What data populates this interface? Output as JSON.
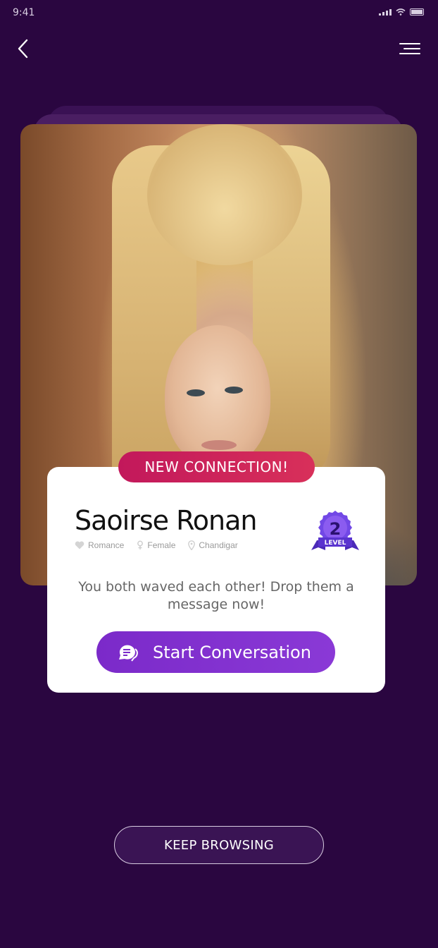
{
  "status_bar": {
    "time": "9:41"
  },
  "nav": {
    "back_icon": "chevron-left-icon",
    "menu_icon": "menu-icon"
  },
  "connection_banner": {
    "label": "NEW CONNECTION!"
  },
  "profile": {
    "name": "Saoirse Ronan",
    "meta": [
      {
        "icon": "heart-icon",
        "label": "Romance"
      },
      {
        "icon": "female-icon",
        "label": "Female"
      },
      {
        "icon": "location-pin-icon",
        "label": "Chandigar"
      }
    ],
    "level_number": "2",
    "level_label": "LEVEL"
  },
  "message": "You both waved each other! Drop them a message now!",
  "start_button": {
    "label": "Start Conversation",
    "icon": "chat-bubble-icon"
  },
  "keep_button": {
    "label": "KEEP BROWSING"
  },
  "colors": {
    "background": "#2a0640",
    "pill": "#c2185b",
    "primary": "#7b2ac9",
    "badge": "#6a3ce0"
  }
}
